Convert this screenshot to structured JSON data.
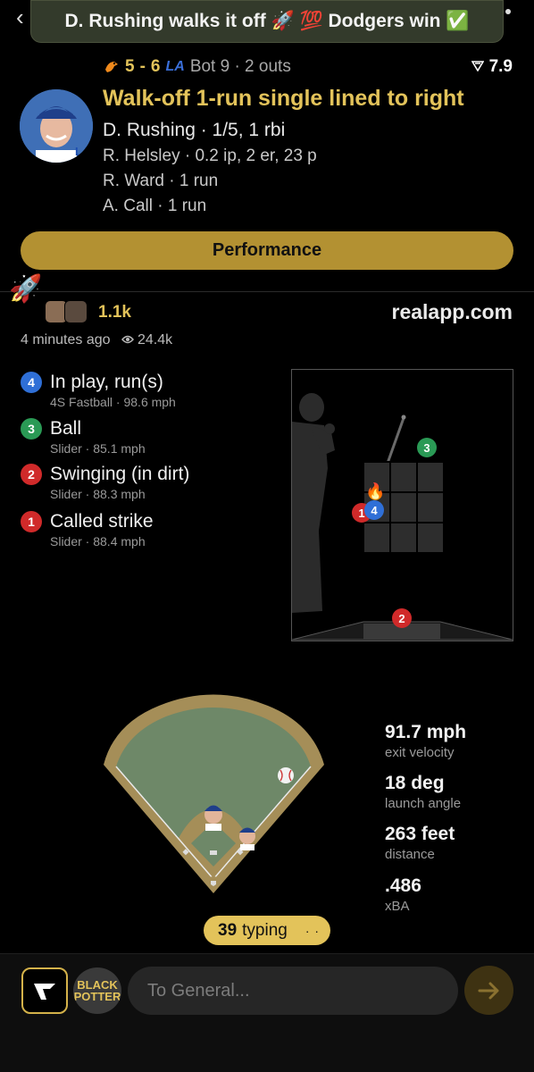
{
  "banner": {
    "text": "D. Rushing walks it off 🚀 💯 Dodgers win ✅"
  },
  "score": {
    "away_runs": "5",
    "home_runs": "6",
    "inning": "Bot 9 · 2 outs",
    "wpa": "7.9"
  },
  "play": {
    "headline": "Walk-off 1-run single lined to right",
    "batter_line": "D. Rushing · 1/5, 1 rbi",
    "pitcher_line": "R. Helsley · 0.2 ip, 2 er, 23 p",
    "runner1_line": "R. Ward · 1 run",
    "runner2_line": "A. Call · 1 run"
  },
  "performance_button": "Performance",
  "reactions": {
    "count": "1.1k",
    "site": "realapp.com",
    "time_ago": "4 minutes ago",
    "views": "24.4k"
  },
  "pitches": [
    {
      "num": "4",
      "color": "#2f6fd6",
      "title": "In play, run(s)",
      "sub": "4S Fastball · 98.6 mph"
    },
    {
      "num": "3",
      "color": "#2a9a55",
      "title": "Ball",
      "sub": "Slider · 85.1 mph"
    },
    {
      "num": "2",
      "color": "#d02a2a",
      "title": "Swinging (in dirt)",
      "sub": "Slider · 88.3 mph"
    },
    {
      "num": "1",
      "color": "#d02a2a",
      "title": "Called strike",
      "sub": "Slider · 88.4 mph"
    }
  ],
  "stats": [
    {
      "value": "91.7 mph",
      "label": "exit velocity"
    },
    {
      "value": "18 deg",
      "label": "launch angle"
    },
    {
      "value": "263 feet",
      "label": "distance"
    },
    {
      "value": ".486",
      "label": "xBA"
    }
  ],
  "typing": {
    "count": "39",
    "label": "typing"
  },
  "composer": {
    "placeholder": "To General...",
    "channel_label": "BLACK POTTER"
  },
  "colors": {
    "accent": "#e3c35a",
    "performance_bg": "#b39132",
    "field_grass": "#6e8868",
    "field_dirt": "#a58e58"
  }
}
